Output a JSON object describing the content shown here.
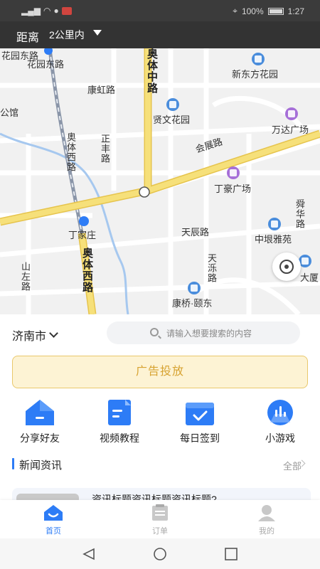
{
  "status_bar": {
    "battery": "100%",
    "time": "1:27"
  },
  "header": {
    "distance_label": "距离",
    "distance_value": "2公里内"
  },
  "map": {
    "labels": {
      "huayuan_east_rd": "花园东路",
      "aoti_mid_rd": "奥体中路",
      "xindongfang": "新东方花园",
      "kanghong_rd": "康虹路",
      "gongguan": "公馆",
      "xianwen": "贤文花园",
      "wanda": "万达广场",
      "zhengfeng_rd": "正丰路",
      "huizhan_rd": "会展路",
      "aoti_west_rd_1": "奥体西路",
      "dinghao": "丁豪广场",
      "fenghua_rd": "舜华路",
      "dingjiazhuang": "丁家庄",
      "tianchen_rd": "天辰路",
      "zhongken": "中垠雅苑",
      "aoti_west_rd_2": "奥体西路",
      "tianle_rd": "天泺路",
      "shanzuo_rd": "山左路",
      "kangqiao": "康桥·颐东",
      "dasha": "大厦"
    }
  },
  "filter": {
    "city": "济南市",
    "search_placeholder": "请输入想要搜索的内容"
  },
  "ad_banner": {
    "label": "广告投放"
  },
  "shortcuts": [
    {
      "label": "分享好友",
      "icon": "home-share-icon"
    },
    {
      "label": "视频教程",
      "icon": "document-icon"
    },
    {
      "label": "每日签到",
      "icon": "checkin-icon"
    },
    {
      "label": "小游戏",
      "icon": "game-chart-icon"
    }
  ],
  "news": {
    "title": "新闻资讯",
    "more": "全部",
    "first_item_title": "资讯标题资讯标题资讯标题?"
  },
  "tabs": [
    {
      "label": "首页",
      "active": true
    },
    {
      "label": "订单",
      "active": false
    },
    {
      "label": "我的",
      "active": false
    }
  ],
  "colors": {
    "accent": "#2d7cf6",
    "topbar": "#333333",
    "ad_text": "#d7a332",
    "ad_bg": "#fdf3d4",
    "road_yellow": "#f6e07a"
  }
}
